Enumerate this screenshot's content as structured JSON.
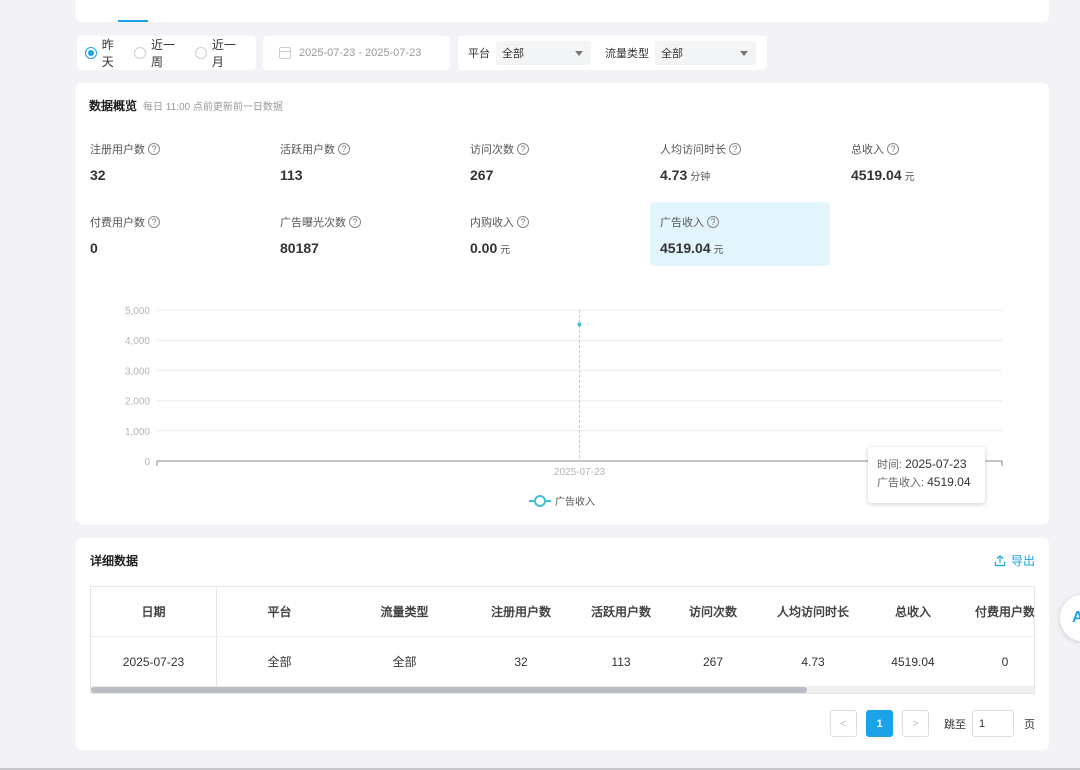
{
  "filters": {
    "range_options": [
      {
        "label": "昨天",
        "checked": true
      },
      {
        "label": "近一周",
        "checked": false
      },
      {
        "label": "近一月",
        "checked": false
      }
    ],
    "date_range": "2025-07-23 - 2025-07-23",
    "platform_label": "平台",
    "platform_value": "全部",
    "traffic_label": "流量类型",
    "traffic_value": "全部"
  },
  "overview": {
    "title": "数据概览",
    "subtitle": "每日 11:00 点前更新前一日数据",
    "metrics": [
      {
        "label": "注册用户数",
        "value": "32",
        "unit": ""
      },
      {
        "label": "活跃用户数",
        "value": "113",
        "unit": ""
      },
      {
        "label": "访问次数",
        "value": "267",
        "unit": ""
      },
      {
        "label": "人均访问时长",
        "value": "4.73",
        "unit": "分钟"
      },
      {
        "label": "总收入",
        "value": "4519.04",
        "unit": "元"
      },
      {
        "label": "付费用户数",
        "value": "0",
        "unit": ""
      },
      {
        "label": "广告曝光次数",
        "value": "80187",
        "unit": ""
      },
      {
        "label": "内购收入",
        "value": "0.00",
        "unit": "元"
      },
      {
        "label": "广告收入",
        "value": "4519.04",
        "unit": "元"
      }
    ],
    "help_icon": "?"
  },
  "chart_data": {
    "type": "line",
    "x": [
      "2025-07-23"
    ],
    "series": [
      {
        "name": "广告收入",
        "values": [
          4519.04
        ]
      }
    ],
    "ylim": [
      0,
      5000
    ],
    "yticks": [
      "0",
      "1,000",
      "2,000",
      "3,000",
      "4,000",
      "5,000"
    ],
    "legend_position": "bottom-center",
    "grid": true,
    "color": "#3fbfd8",
    "tooltip": {
      "time_label": "时间:",
      "time_value": "2025-07-23",
      "value_label": "广告收入:",
      "value": "4519.04"
    }
  },
  "detail": {
    "title": "详细数据",
    "export_label": "导出",
    "columns": [
      "日期",
      "平台",
      "流量类型",
      "注册用户数",
      "活跃用户数",
      "访问次数",
      "人均访问时长",
      "总收入",
      "付费用户数"
    ],
    "rows": [
      [
        "2025-07-23",
        "全部",
        "全部",
        "32",
        "113",
        "267",
        "4.73",
        "4519.04",
        "0"
      ]
    ]
  },
  "pagination": {
    "prev": "<",
    "current": "1",
    "next": ">",
    "jump_label": "跳至",
    "jump_value": "1",
    "page_suffix": "页"
  },
  "side_float_label": "A"
}
